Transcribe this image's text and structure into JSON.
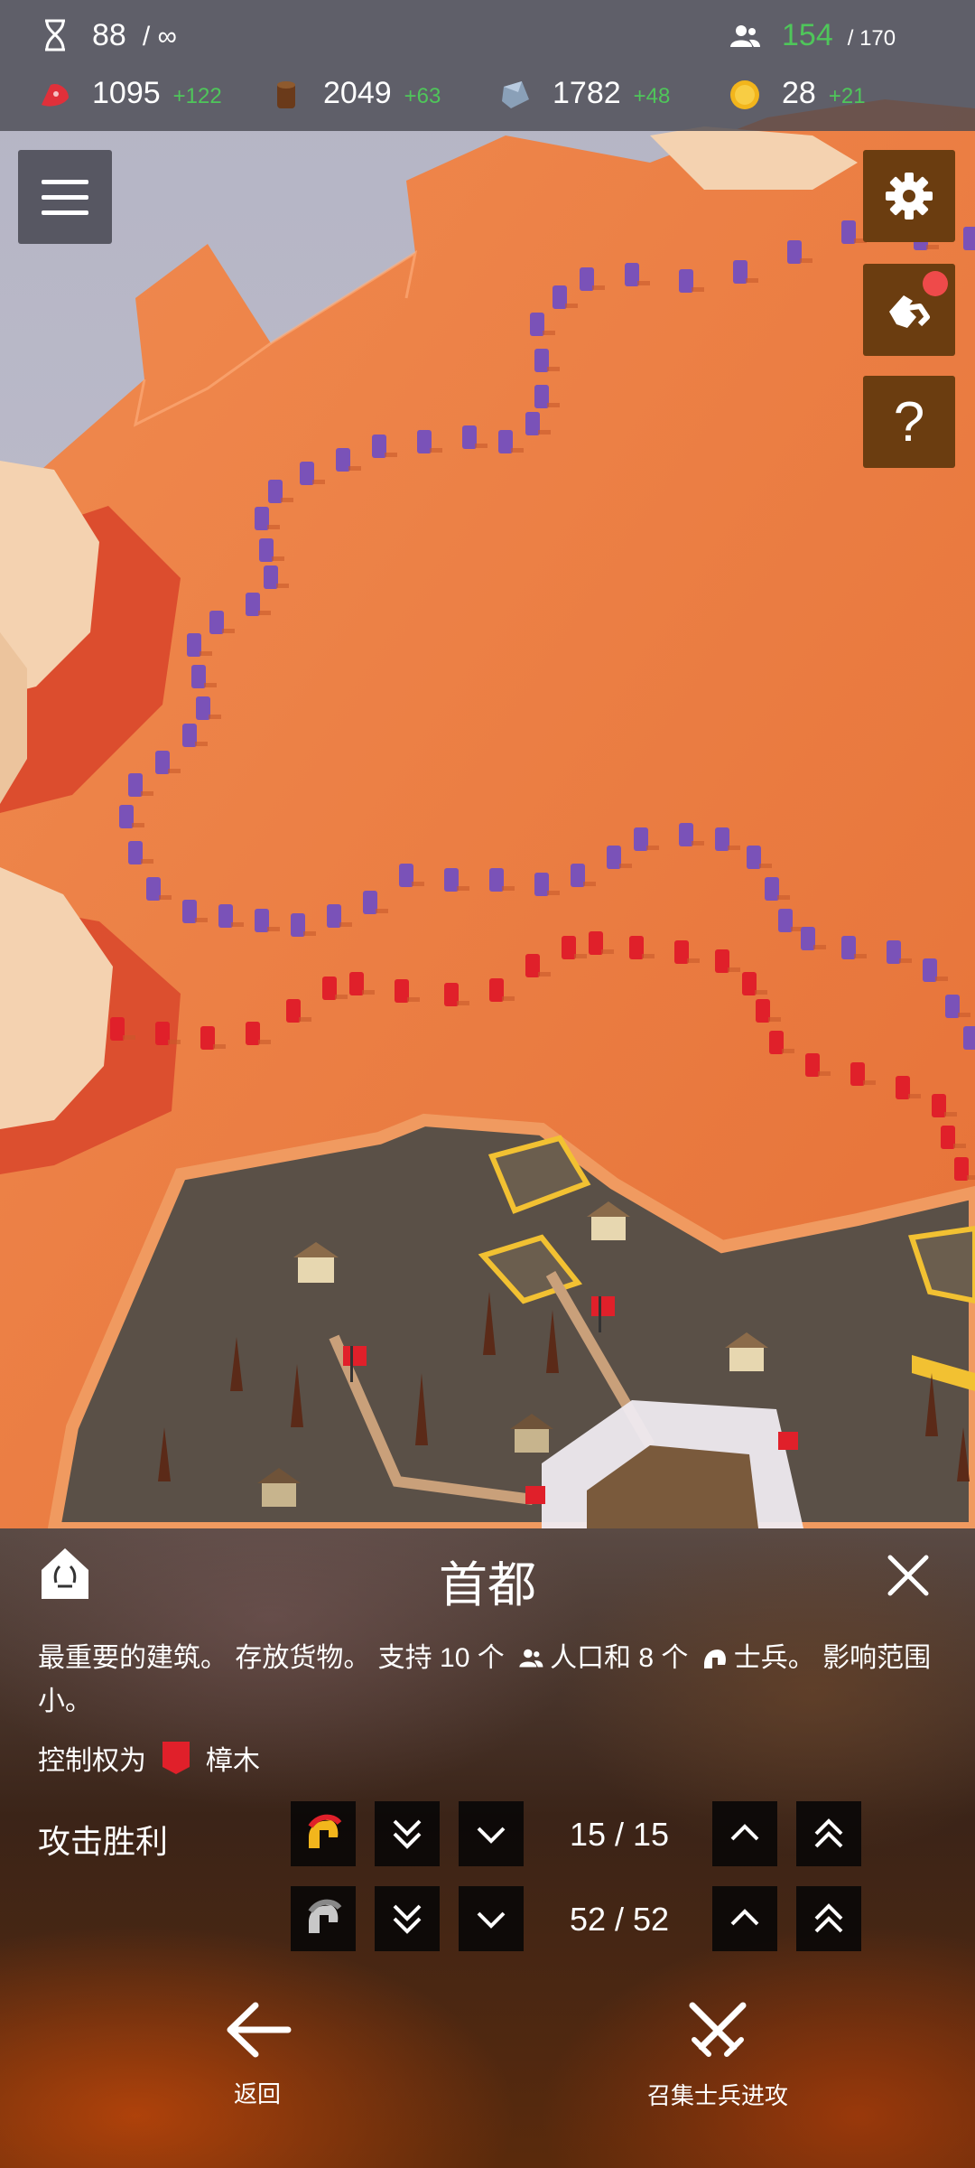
{
  "top_bar": {
    "turns": {
      "value": "88",
      "max": "/ ∞"
    },
    "population": {
      "value": "154",
      "max": "/ 170"
    },
    "food": {
      "value": "1095",
      "delta": "+122"
    },
    "wood": {
      "value": "2049",
      "delta": "+63"
    },
    "stone": {
      "value": "1782",
      "delta": "+48"
    },
    "gold": {
      "value": "28",
      "delta": "+21"
    }
  },
  "side_buttons": {
    "menu": "menu-icon",
    "settings": "gear-icon",
    "diplomacy": "handshake-icon",
    "help": "?"
  },
  "panel": {
    "title": "首都",
    "description_part1": "最重要的建筑。 存放货物。 支持 10 个",
    "description_part2": "人口和 8 个",
    "description_part3": "士兵。 影响范围小。",
    "control_label": "控制权为",
    "control_owner": "樟木",
    "owner_color": "#e0202a",
    "attack_label": "攻击胜利",
    "rows": [
      {
        "unit_icon": "spartan-helmet-icon",
        "count": "15 / 15"
      },
      {
        "unit_icon": "helmet-icon",
        "count": "52 / 52"
      }
    ],
    "back_label": "返回",
    "attack_button_label": "召集士兵进攻"
  },
  "colors": {
    "terrain": "#e8793f",
    "player_red": "#e0202a",
    "enemy_purple": "#7a52b8",
    "positive_delta": "#4fc65a",
    "button_brown": "#6b3d10"
  }
}
